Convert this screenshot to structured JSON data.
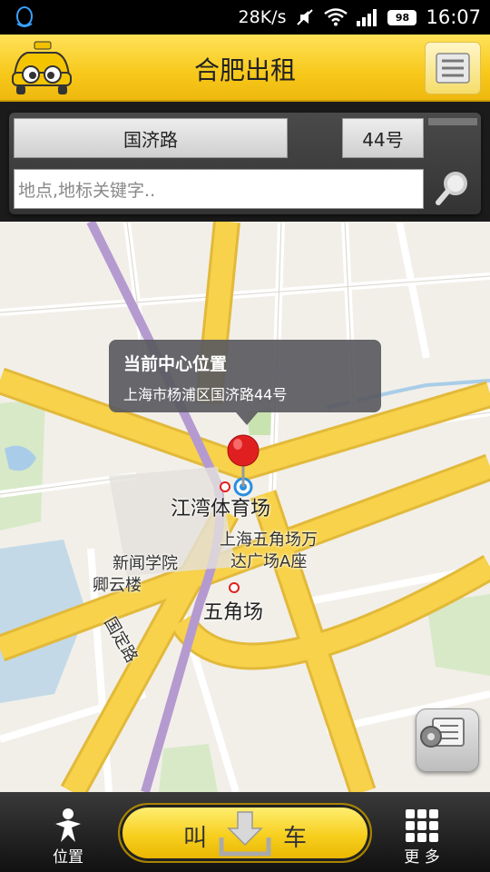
{
  "status_bar": {
    "net_speed": "28K/s",
    "battery": "98",
    "time": "16:07"
  },
  "header": {
    "title": "合肥出租",
    "logo_icon": "taxi-logo-icon",
    "menu_icon": "list-menu-icon"
  },
  "search": {
    "road": "国济路",
    "number": "44号",
    "placeholder": "地点,地标关键字..",
    "search_icon": "search-icon"
  },
  "map": {
    "callout": {
      "title": "当前中心位置",
      "address": "上海市杨浦区国济路44号"
    },
    "pois": {
      "stadium": "江湾体育场",
      "plaza_line1": "上海五角场万",
      "plaza_line2": "达广场A座",
      "news_school": "新闻学院",
      "qingyun": "卿云楼",
      "wujiaochang": "五角场",
      "guoding_road": "国定路"
    },
    "colors": {
      "major_road": "#f7d24a",
      "minor_road": "#ffffff",
      "metro_line": "#b59ad0",
      "green": "#c8e3b0",
      "water": "#a9cde8",
      "pin": "#e02020"
    }
  },
  "bottom_bar": {
    "location_label": "位置",
    "call_left": "叫",
    "call_right": "车",
    "more_label": "更 多"
  }
}
